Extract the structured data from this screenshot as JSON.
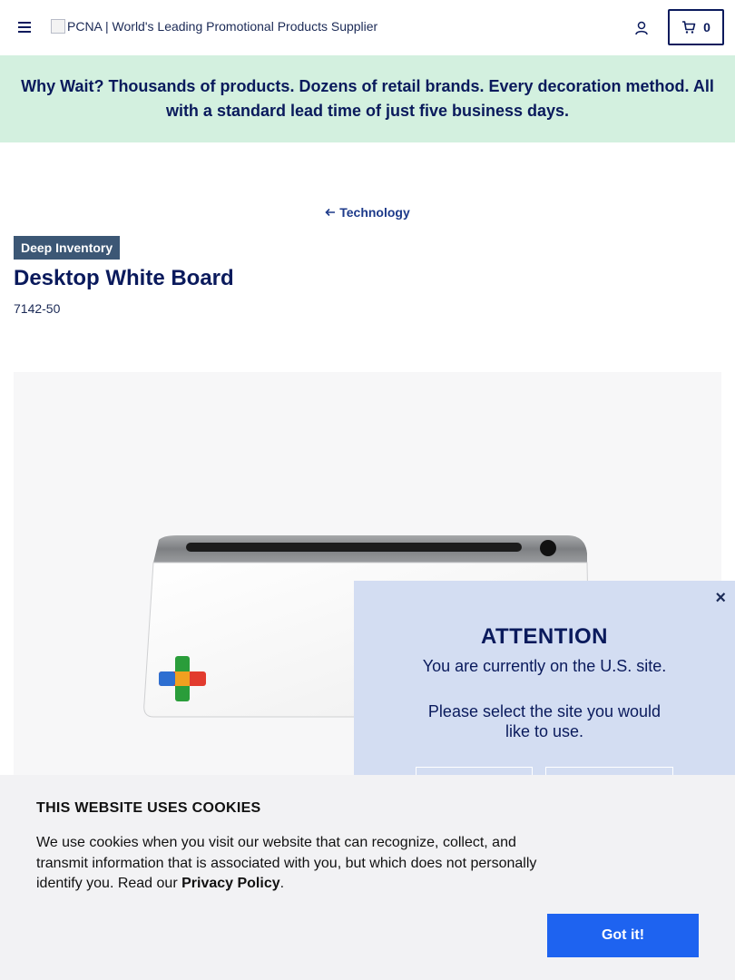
{
  "header": {
    "logo_alt": "PCNA | World's Leading Promotional Products Supplier",
    "cart_count": "0"
  },
  "promo": {
    "text": "Why Wait? Thousands of products. Dozens of retail brands. Every decoration method. All with a standard lead time of just five business days."
  },
  "breadcrumb": {
    "back_label": "Technology"
  },
  "product": {
    "badge": "Deep Inventory",
    "title": "Desktop White Board",
    "sku": "7142-50"
  },
  "popup": {
    "close_label": "×",
    "title": "ATTENTION",
    "line1": "You are currently on the U.S. site.",
    "line2": "Please select the site you would like to use."
  },
  "cookie": {
    "title": "THIS WEBSITE USES COOKIES",
    "text_before_link": "We use cookies when you visit our website that can recognize, collect, and transmit information that is associated with you, but which does not personally identify you. Read our ",
    "link_label": "Privacy Policy",
    "text_after_link": ".",
    "button_label": "Got it!"
  },
  "icons": {
    "menu": "hamburger-icon",
    "account": "user-icon",
    "cart": "cart-icon",
    "back": "arrow-left-icon",
    "close": "close-icon"
  },
  "colors": {
    "brand_navy": "#0a1a5c",
    "promo_bg": "#d3f0df",
    "badge_bg": "#3c5775",
    "popup_bg": "#d3ddf2",
    "cookie_bg": "#f2f2f4",
    "accent_blue": "#1e63f0"
  }
}
